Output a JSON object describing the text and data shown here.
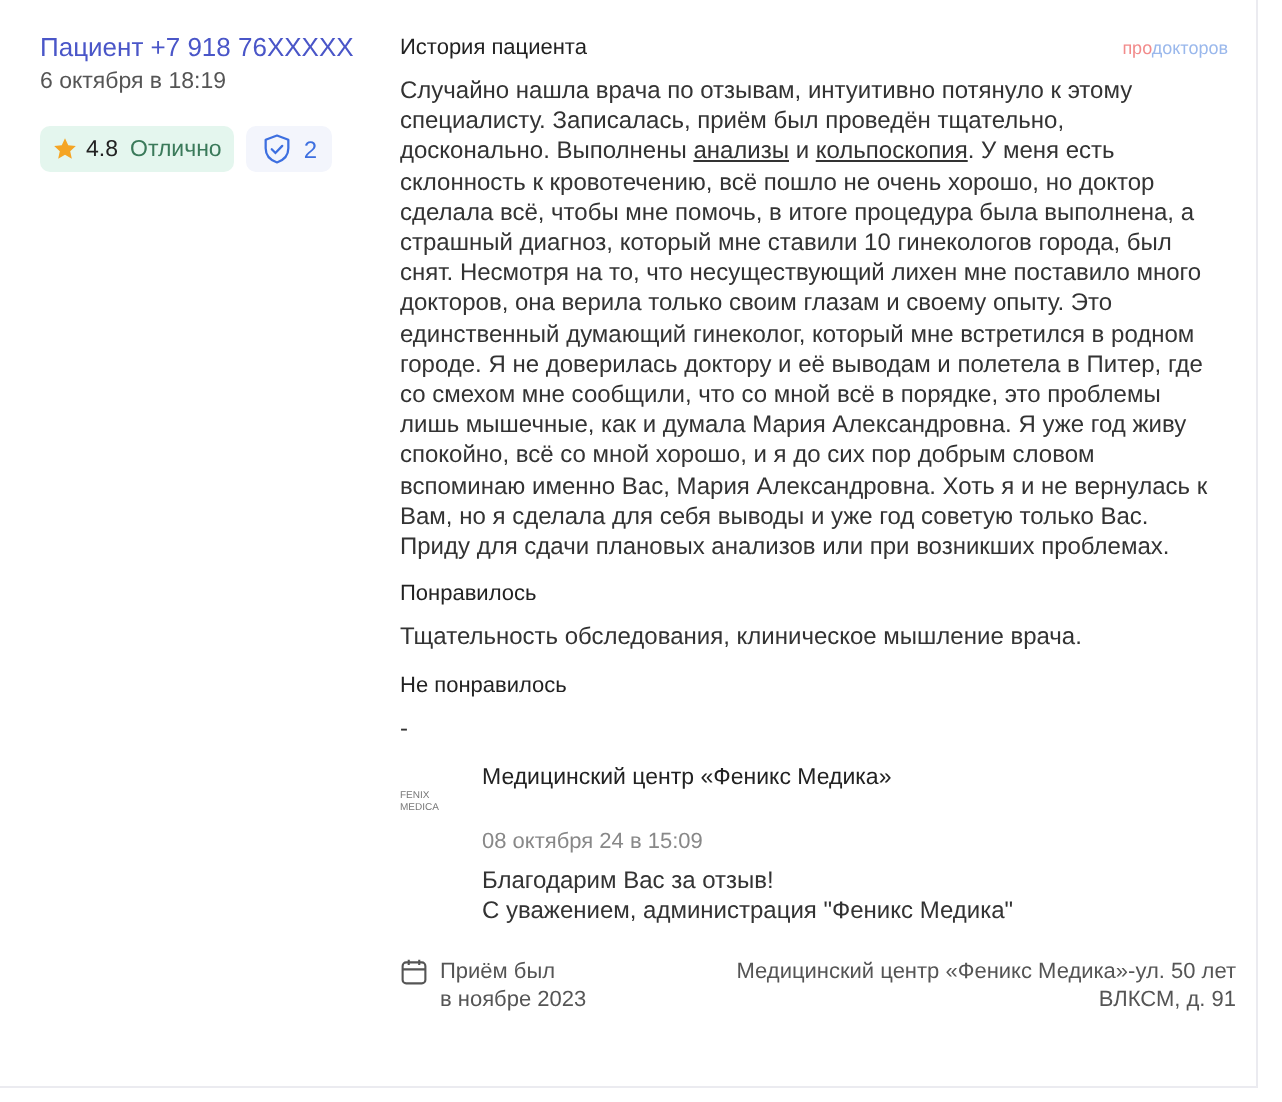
{
  "author": {
    "name": "Пациент +7 918 76XXXXX",
    "date": "6 октября в 18:19"
  },
  "rating": {
    "value": "4.8",
    "label": "Отлично"
  },
  "verified": {
    "count": "2"
  },
  "section_title": "История пациента",
  "brand": {
    "part_1": "про",
    "part_2": "докторов"
  },
  "story": [
    {
      "text": "Случайно нашла врача по отзывам, интуитивно потянуло к этому специалисту. Записалась, приём был проведён тщательно, досконально. Выполнены ",
      "link": false
    },
    {
      "text": "анализы",
      "link": true
    },
    {
      "text": " и ",
      "link": false
    },
    {
      "text": "кольпоскопия",
      "link": true
    },
    {
      "text": ". У меня есть склонность к кровотечению, всё пошло не очень хорошо, но доктор сделала всё, чтобы мне помочь, в итоге процедура была выполнена, а страшный диагноз, который мне ставили 10 гинекологов города, был снят. Несмотря на то, что несуществующий лихен мне поставило много докторов, она верила только своим глазам и своему опыту. Это единственный думающий гинеколог, который мне встретился в родном городе. Я не доверилась доктору и её выводам и полетела в Питер, где со смехом мне сообщили, что со мной всё в порядке, это проблемы лишь мышечные, как и думала Мария Александровна. Я уже год живу спокойно, всё со мной хорошо, и я до сих пор добрым словом вспоминаю именно Вас, Мария Александровна. Хоть я и не вернулась к Вам, но я сделала для себя выводы и уже год советую только Вас. Приду для сдачи плановых анализов или при возникших проблемах.",
      "link": false
    }
  ],
  "liked": {
    "title": "Понравилось",
    "text": "Тщательность обследования, клиническое мышление врача."
  },
  "disliked": {
    "title": "Не понравилось",
    "text": "-"
  },
  "reply": {
    "logo_lines": [
      "FENIX",
      "MEDICA"
    ],
    "clinic": "Медицинский центр «Феникс Медика»",
    "date": "08 октября 24 в 15:09",
    "lines": [
      "Благодарим Вас за отзыв!",
      "С уважением, администрация \"Феникс Медика\""
    ]
  },
  "visit": {
    "lines": [
      "Приём был",
      "в ноябре 2023"
    ],
    "place_lines": [
      "Медицинский центр «Феникс Медика»-ул. 50 лет",
      "ВЛКСМ, д. 91"
    ]
  }
}
